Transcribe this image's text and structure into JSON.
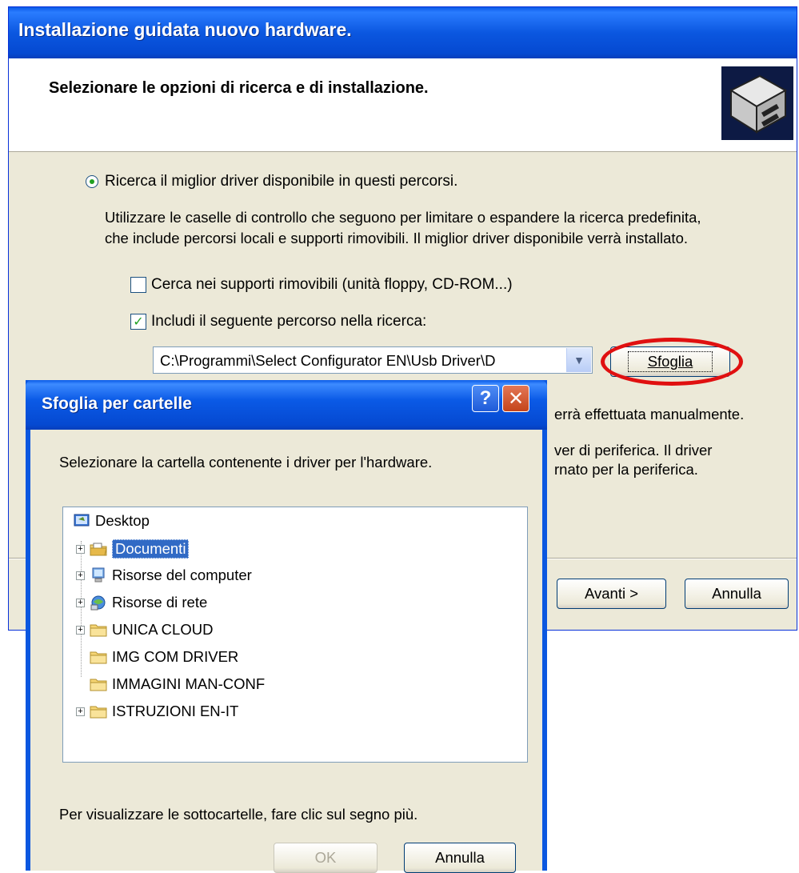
{
  "wizard": {
    "title": "Installazione guidata nuovo hardware.",
    "heading": "Selezionare le opzioni di ricerca e di installazione.",
    "radio_label": "Ricerca il miglior driver disponibile in questi percorsi.",
    "description_line1": "Utilizzare le caselle di controllo che seguono per limitare o espandere la ricerca predefinita,",
    "description_line2": "che include percorsi locali e supporti rimovibili. Il miglior driver disponibile verrà installato.",
    "checkbox_removable_label": "Cerca nei supporti rimovibili (unità floppy, CD-ROM...)",
    "checkbox_removable_checked": false,
    "checkbox_path_label": "Includi il seguente percorso nella ricerca:",
    "checkbox_path_checked": true,
    "path_value": "C:\\Programmi\\Select Configurator EN\\Usb Driver\\D",
    "browse_button": "Sfoglia",
    "partial_line1": "errà effettuata manualmente.",
    "partial_line2": "ver di periferica. Il driver",
    "partial_line3": "rnato per la periferica.",
    "next_button": "Avanti >",
    "cancel_button": "Annulla"
  },
  "browse_dialog": {
    "title": "Sfoglia per cartelle",
    "instruction": "Selezionare la cartella contenente i driver per l'hardware.",
    "tree": [
      {
        "label": "Desktop",
        "icon": "desktop-icon",
        "expandable": false,
        "selected": false
      },
      {
        "label": "Documenti",
        "icon": "documents-folder-icon",
        "expandable": true,
        "selected": true
      },
      {
        "label": "Risorse del computer",
        "icon": "computer-icon",
        "expandable": true,
        "selected": false
      },
      {
        "label": "Risorse di rete",
        "icon": "network-icon",
        "expandable": true,
        "selected": false
      },
      {
        "label": "UNICA CLOUD",
        "icon": "folder-icon",
        "expandable": true,
        "selected": false
      },
      {
        "label": "IMG COM DRIVER",
        "icon": "folder-icon",
        "expandable": false,
        "selected": false
      },
      {
        "label": "IMMAGINI MAN-CONF",
        "icon": "folder-icon",
        "expandable": false,
        "selected": false
      },
      {
        "label": "ISTRUZIONI EN-IT",
        "icon": "folder-icon",
        "expandable": true,
        "selected": false
      }
    ],
    "hint": "Per visualizzare le sottocartelle, fare clic sul segno più.",
    "ok_button": "OK",
    "ok_enabled": false,
    "cancel_button": "Annulla",
    "help_glyph": "?",
    "close_glyph": "✕"
  },
  "colors": {
    "titlebar": "#0b57e0",
    "window_bg": "#ece9d8",
    "selection": "#316ac5",
    "highlight_ring": "#e01010"
  }
}
